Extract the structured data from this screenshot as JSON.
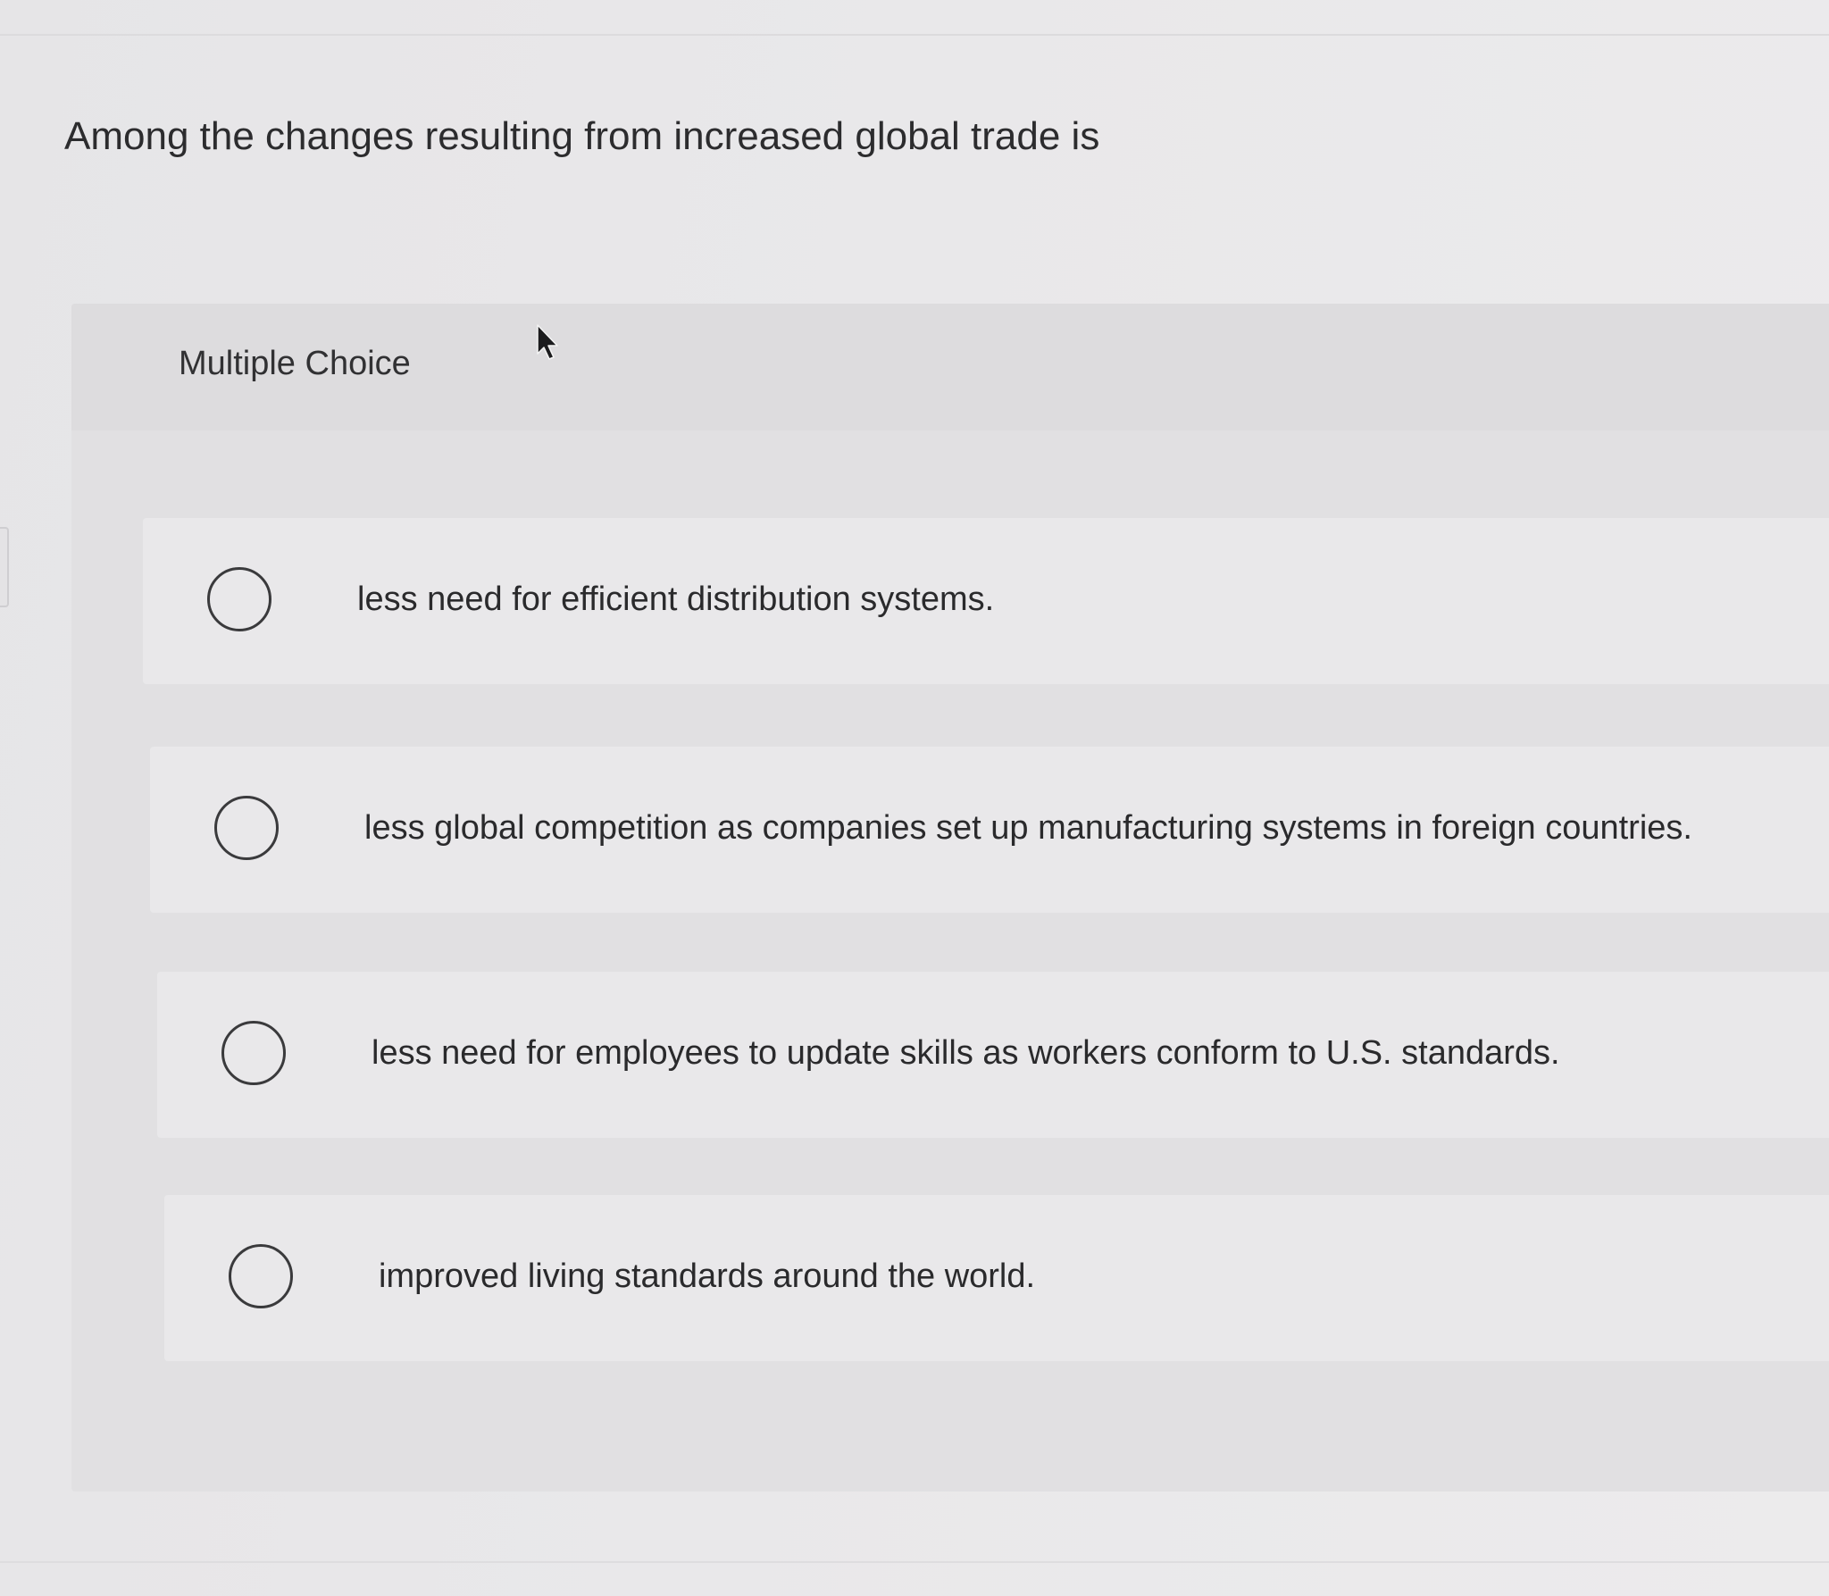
{
  "question": {
    "text": "Among the changes resulting from increased global trade is"
  },
  "section": {
    "label": "Multiple Choice"
  },
  "options": [
    {
      "label": "less need for efficient distribution systems.",
      "selected": false
    },
    {
      "label": "less global competition as companies set up manufacturing systems in foreign countries.",
      "selected": false
    },
    {
      "label": "less need for employees to update skills as workers conform to U.S. standards.",
      "selected": false
    },
    {
      "label": "improved living standards around the world.",
      "selected": false
    }
  ],
  "icons": {
    "cursor": "mouse-pointer-icon",
    "radio": "radio-button-unchecked"
  }
}
